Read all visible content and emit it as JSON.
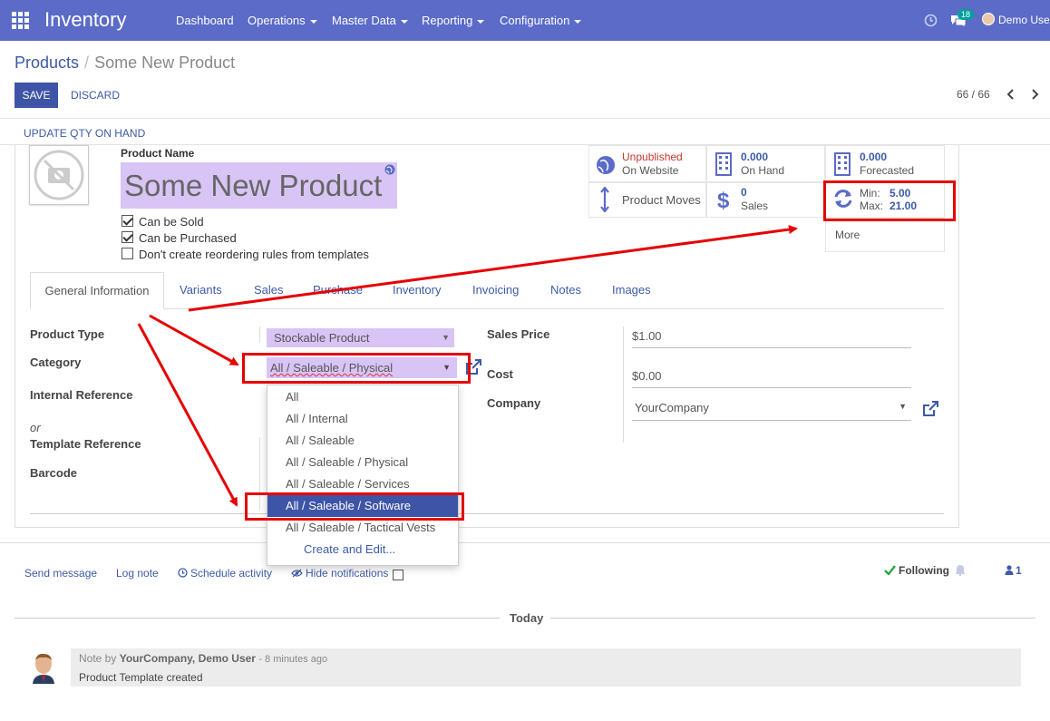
{
  "navbar": {
    "brand": "Inventory",
    "menus": [
      "Dashboard",
      "Operations",
      "Master Data",
      "Reporting",
      "Configuration"
    ],
    "badge": "18",
    "user": "Demo User"
  },
  "breadcrumb": {
    "parent": "Products",
    "current": "Some New Product"
  },
  "buttons": {
    "save": "SAVE",
    "discard": "DISCARD",
    "update_qty": "UPDATE QTY ON HAND"
  },
  "pager": {
    "text": "66 / 66"
  },
  "product": {
    "name_label": "Product Name",
    "name": "Some New Product",
    "checks": [
      {
        "label": "Can be Sold",
        "checked": true
      },
      {
        "label": "Can be Purchased",
        "checked": true
      },
      {
        "label": "Don't create reordering rules from templates",
        "checked": false
      }
    ]
  },
  "stats": {
    "unpublished": "Unpublished",
    "on_website": "On Website",
    "on_hand_num": "0.000",
    "on_hand": "On Hand",
    "forecasted_num": "0.000",
    "forecasted": "Forecasted",
    "moves": "Product Moves",
    "sales_num": "0",
    "sales": "Sales",
    "min_label": "Min:",
    "min_val": "5.00",
    "max_label": "Max:",
    "max_val": "21.00",
    "more": "More"
  },
  "tabs": [
    "General Information",
    "Variants",
    "Sales",
    "Purchase",
    "Inventory",
    "Invoicing",
    "Notes",
    "Images"
  ],
  "fields": {
    "product_type_label": "Product Type",
    "product_type": "Stockable Product",
    "category_label": "Category",
    "category": "All / Saleable / Physical",
    "internal_ref_label": "Internal Reference",
    "or": "or",
    "template_ref_label": "Template Reference",
    "barcode_label": "Barcode",
    "sales_price_label": "Sales Price",
    "sales_price": "$1.00",
    "cost_label": "Cost",
    "cost": "$0.00",
    "company_label": "Company",
    "company": "YourCompany"
  },
  "dropdown": {
    "items": [
      "All",
      "All / Internal",
      "All / Saleable",
      "All / Saleable / Physical",
      "All / Saleable / Services",
      "All / Saleable / Software",
      "All / Saleable / Tactical Vests"
    ],
    "create": "Create and Edit...",
    "selected_index": 5
  },
  "chatter": {
    "send": "Send message",
    "log": "Log note",
    "schedule": "Schedule activity",
    "hide": "Hide notifications",
    "following": "Following",
    "followers": "1",
    "today": "Today",
    "note_prefix": "Note by",
    "note_author": "YourCompany, Demo User",
    "note_time": "- 8 minutes ago",
    "note_body": "Product Template created"
  },
  "colors": {
    "navbar": "#5b6bc7",
    "primary": "#3e54a6",
    "highlight": "#d8c4f5",
    "annotation": "#e60000"
  }
}
